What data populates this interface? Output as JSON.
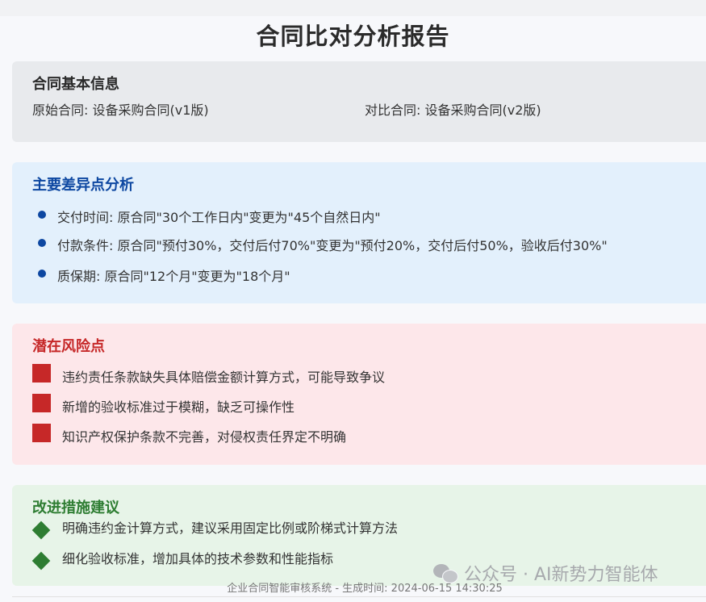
{
  "title": "合同比对分析报告",
  "info": {
    "heading": "合同基本信息",
    "original": "原始合同: 设备采购合同(v1版)",
    "compare": "对比合同: 设备采购合同(v2版)"
  },
  "differences": {
    "heading": "主要差异点分析",
    "items": [
      "交付时间: 原合同\"30个工作日内\"变更为\"45个自然日内\"",
      "付款条件: 原合同\"预付30%，交付后付70%\"变更为\"预付20%，交付后付50%，验收后付30%\"",
      "质保期: 原合同\"12个月\"变更为\"18个月\""
    ]
  },
  "risks": {
    "heading": "潜在风险点",
    "items": [
      "违约责任条款缺失具体赔偿金额计算方式，可能导致争议",
      "新增的验收标准过于模糊，缺乏可操作性",
      "知识产权保护条款不完善，对侵权责任界定不明确"
    ]
  },
  "improvements": {
    "heading": "改进措施建议",
    "items": [
      "明确违约金计算方式，建议采用固定比例或阶梯式计算方法",
      "细化验收标准，增加具体的技术参数和性能指标"
    ]
  },
  "footer": "企业合同智能审核系统 - 生成时间: 2024-06-15 14:30:25",
  "watermark": "公众号 · AI新势力智能体",
  "colors": {
    "diff_accent": "#0d47a1",
    "risk_accent": "#c62828",
    "improve_accent": "#2e7d32"
  }
}
